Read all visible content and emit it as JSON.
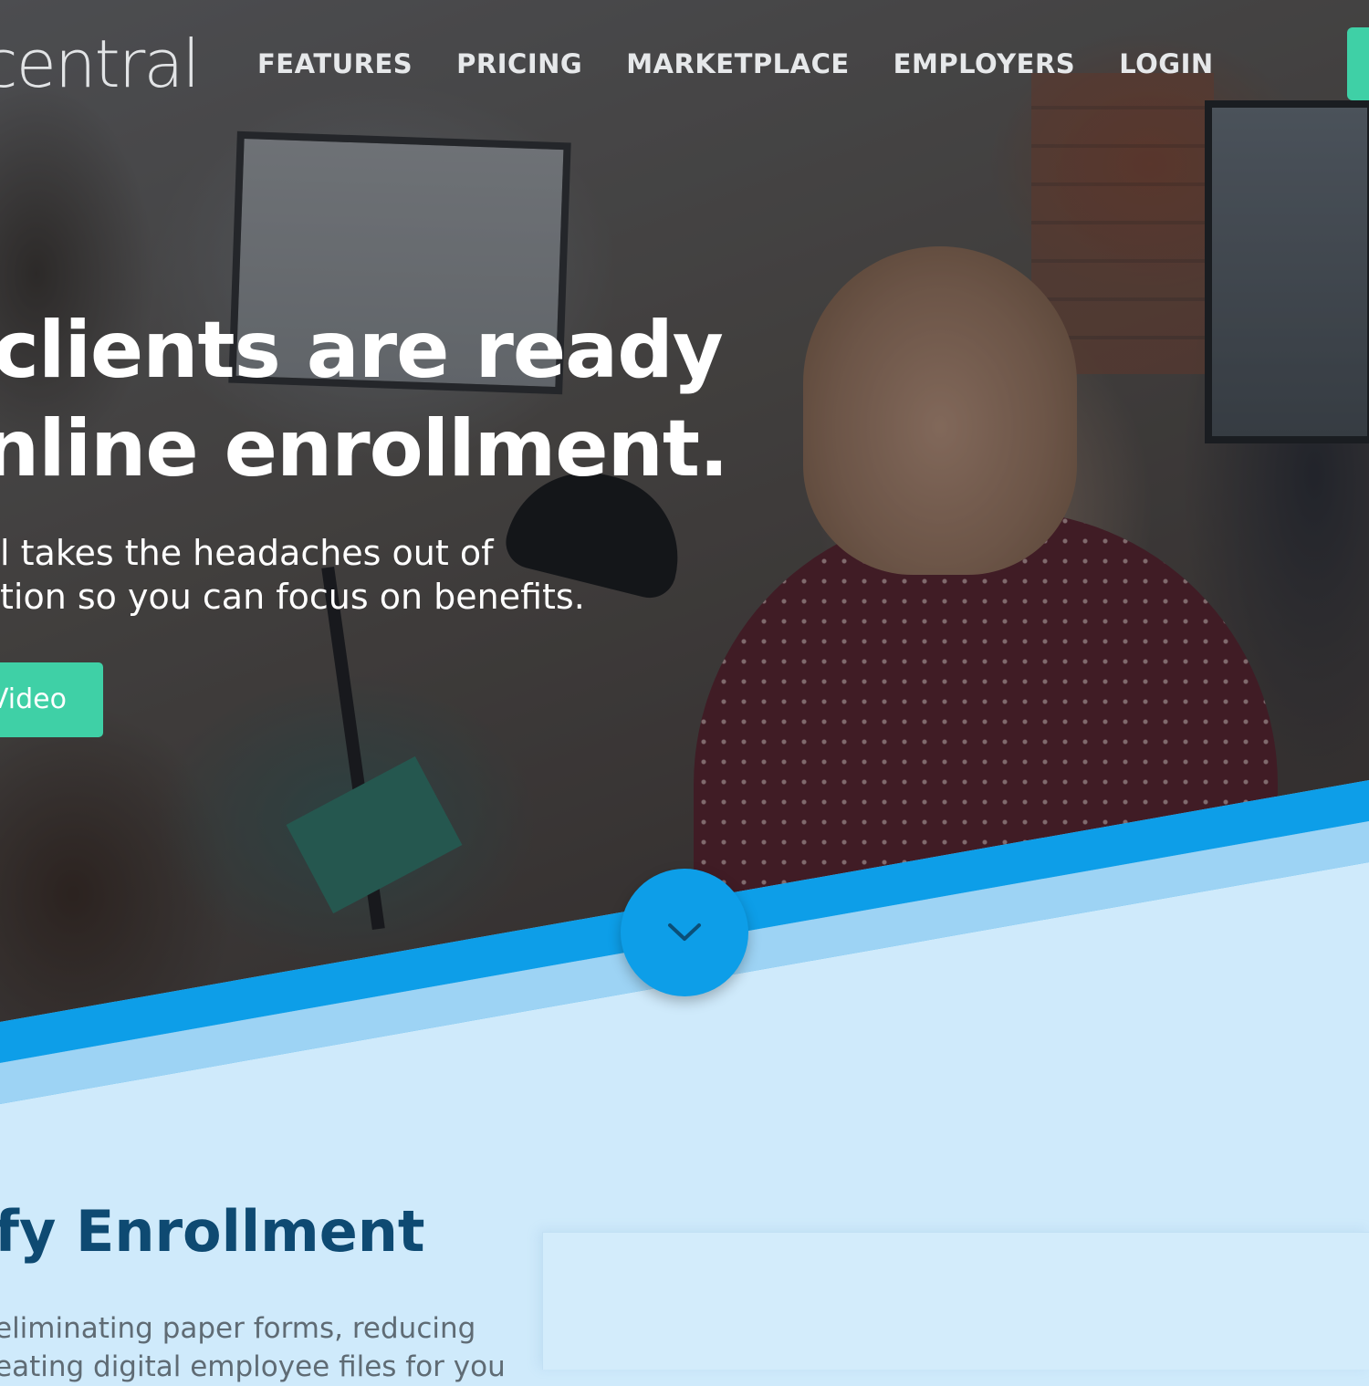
{
  "header": {
    "logo_text": "central",
    "nav": [
      {
        "label": "FEATURES"
      },
      {
        "label": "PRICING"
      },
      {
        "label": "MARKETPLACE"
      },
      {
        "label": "EMPLOYERS"
      },
      {
        "label": "LOGIN"
      }
    ]
  },
  "hero": {
    "headline_line1": "clients are ready",
    "headline_line2": "nline enrollment.",
    "subtext_line1": "l takes the headaches out of",
    "subtext_line2": "tion so you can focus on benefits.",
    "video_button_label": "Video"
  },
  "section": {
    "title": "fy Enrollment",
    "body_line1": "eliminating paper forms, reducing",
    "body_line2": "eating digital employee files for you"
  },
  "colors": {
    "accent_green": "#3fd0a6",
    "accent_blue": "#0d9ee8",
    "light_blue_band": "#9dd3f4",
    "section_bg": "#cfeafb",
    "title_blue": "#0e4a72"
  },
  "icons": {
    "scroll_down": "chevron-down-icon"
  }
}
